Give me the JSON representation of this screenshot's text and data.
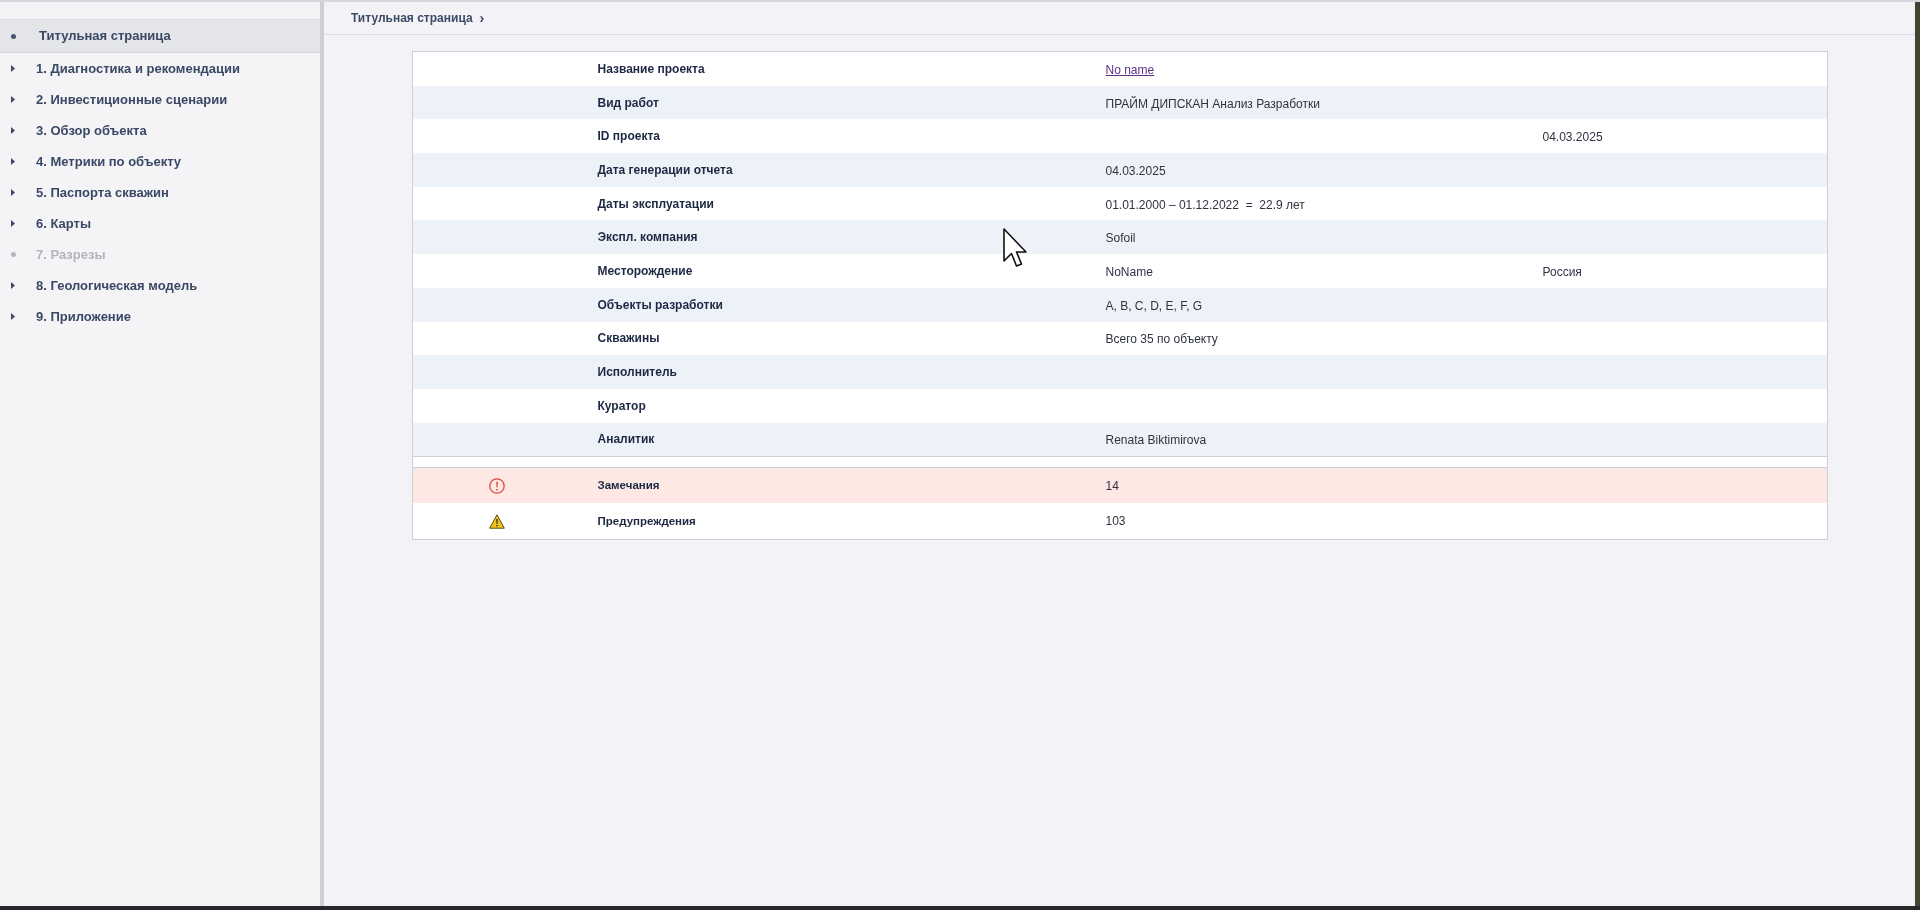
{
  "sidebar": {
    "items": [
      {
        "label": "Титульная страница",
        "kind": "leaf",
        "selected": true,
        "disabled": false
      },
      {
        "label": "1. Диагностика и рекомендации",
        "kind": "branch",
        "selected": false,
        "disabled": false
      },
      {
        "label": "2. Инвестиционные сценарии",
        "kind": "branch",
        "selected": false,
        "disabled": false
      },
      {
        "label": "3. Обзор объекта",
        "kind": "branch",
        "selected": false,
        "disabled": false
      },
      {
        "label": "4. Метрики по объекту",
        "kind": "branch",
        "selected": false,
        "disabled": false
      },
      {
        "label": "5. Паспорта скважин",
        "kind": "branch",
        "selected": false,
        "disabled": false
      },
      {
        "label": "6. Карты",
        "kind": "branch",
        "selected": false,
        "disabled": false
      },
      {
        "label": "7. Разрезы",
        "kind": "leaf",
        "selected": false,
        "disabled": true
      },
      {
        "label": "8. Геологическая модель",
        "kind": "branch",
        "selected": false,
        "disabled": false
      },
      {
        "label": "9. Приложение",
        "kind": "branch",
        "selected": false,
        "disabled": false
      }
    ]
  },
  "breadcrumb": [
    {
      "label": "Титульная страница",
      "separator": "›"
    }
  ],
  "project_table": {
    "rows": [
      {
        "label": "Название проекта",
        "value": "No name",
        "kind": "link"
      },
      {
        "label": "Вид работ",
        "value": "ПРАЙМ ДИПСКАН Анализ Разработки",
        "kind": "text"
      },
      {
        "label": "ID проекта",
        "column_3": "04.03.2025"
      },
      {
        "label": "Дата генерации отчета",
        "value": "04.03.2025",
        "kind": "text"
      },
      {
        "label": "Даты эксплуатации",
        "value": "01.01.2000 – 01.12.2022  =  22.9 лет",
        "kind": "text"
      },
      {
        "label": "Экспл. компания",
        "value": "Sofoil",
        "kind": "text"
      },
      {
        "label": "Месторождение",
        "value": "NoName",
        "column_3": "Россия",
        "kind": "text"
      },
      {
        "label": "Объекты разработки",
        "value": "A, B, C, D, E, F, G",
        "kind": "text"
      },
      {
        "label": "Скважины",
        "value": "Всего 35 по объекту",
        "kind": "text"
      },
      {
        "label": "Исполнитель"
      },
      {
        "label": "Куратор"
      },
      {
        "label": "Аналитик",
        "value": "Renata Biktimirova",
        "kind": "text"
      }
    ]
  },
  "alerts": [
    {
      "kind": "error",
      "label": "Замечания",
      "count": "14"
    },
    {
      "kind": "warning",
      "label": "Предупреждения",
      "count": "103"
    }
  ]
}
